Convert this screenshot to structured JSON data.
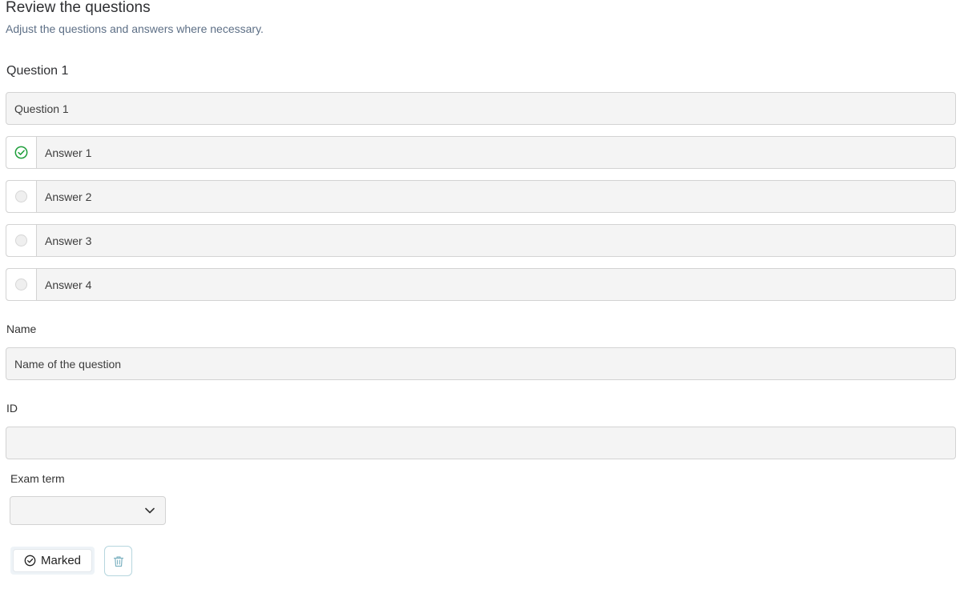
{
  "header": {
    "title": "Review the questions",
    "subtitle": "Adjust the questions and answers where necessary."
  },
  "question": {
    "heading": "Question 1",
    "text_value": "Question 1",
    "answers": [
      {
        "label": "Answer 1",
        "correct": true,
        "icon": "check-circle-icon"
      },
      {
        "label": "Answer 2",
        "correct": false,
        "icon": "radio-empty-icon"
      },
      {
        "label": "Answer 3",
        "correct": false,
        "icon": "radio-empty-icon"
      },
      {
        "label": "Answer 4",
        "correct": false,
        "icon": "radio-empty-icon"
      }
    ]
  },
  "name_field": {
    "label": "Name",
    "value": "Name of the question"
  },
  "id_field": {
    "label": "ID",
    "value": ""
  },
  "exam_term": {
    "label": "Exam term",
    "selected": ""
  },
  "actions": {
    "marked_label": "Marked",
    "marked_icon": "check-circle-icon",
    "delete_icon": "trash-icon"
  },
  "colors": {
    "correct_green": "#1e9e3a",
    "subtitle": "#5d6f86",
    "field_bg": "#f4f4f4",
    "delete_border": "#b6d6de"
  }
}
